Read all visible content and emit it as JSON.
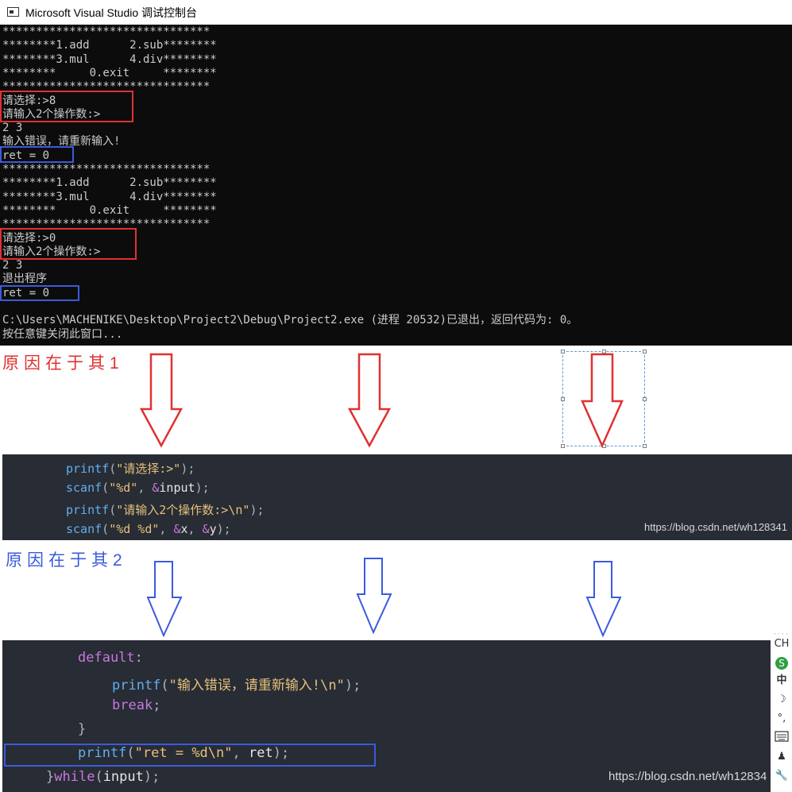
{
  "window": {
    "title": "Microsoft Visual Studio 调试控制台"
  },
  "console_lines": [
    "*******************************",
    "********1.add      2.sub********",
    "********3.mul      4.div********",
    "********     0.exit     ********",
    "*******************************",
    "请选择:>8",
    "请输入2个操作数:>",
    "2 3",
    "输入错误，请重新输入!",
    "ret = 0",
    "*******************************",
    "********1.add      2.sub********",
    "********3.mul      4.div********",
    "********     0.exit     ********",
    "*******************************",
    "请选择:>0",
    "请输入2个操作数:>",
    "2 3",
    "退出程序",
    "ret = 0",
    "",
    "C:\\Users\\MACHENIKE\\Desktop\\Project2\\Debug\\Project2.exe (进程 20532)已退出，返回代码为: 0。",
    "按任意键关闭此窗口..."
  ],
  "headings": {
    "reason1": "原因在于其1",
    "reason2": "原因在于其2"
  },
  "code1": {
    "l1": {
      "fn": "printf",
      "open": "(",
      "str": "\"请选择:>\"",
      "close": ");"
    },
    "l2": {
      "fn": "scanf",
      "open": "(",
      "str": "\"%d\"",
      "sep": ", ",
      "amp": "&",
      "id": "input",
      "close": ");"
    },
    "l3": {
      "fn": "printf",
      "open": "(",
      "str": "\"请输入2个操作数:>\\n\"",
      "close": ");"
    },
    "l4": {
      "fn": "scanf",
      "open": "(",
      "str": "\"%d %d\"",
      "sep1": ", ",
      "amp1": "&",
      "id1": "x",
      "sep2": ", ",
      "amp2": "&",
      "id2": "y",
      "close": ");"
    },
    "watermark": "https://blog.csdn.net/wh128341"
  },
  "code2": {
    "l1": {
      "kw": "default",
      "punc": ":"
    },
    "l2": {
      "fn": "printf",
      "open": "(",
      "str": "\"输入错误，请重新输入!\\n\"",
      "close": ");"
    },
    "l3": {
      "kw": "break",
      "punc": ";"
    },
    "l4": {
      "punc": "}"
    },
    "l5": {
      "fn": "printf",
      "open": "(",
      "str": "\"ret = %d\\n\"",
      "sep": ", ",
      "id": "ret",
      "close": ");"
    },
    "l6": {
      "brace": "}",
      "kw": "while",
      "open": "(",
      "id": "input",
      "close": ");"
    },
    "watermark": "https://blog.csdn.net/wh12834"
  },
  "ime": {
    "lang": "CH",
    "mode": "中"
  },
  "colors": {
    "red": "#e03131",
    "blue": "#3b5bdb",
    "console_bg": "#0c0c0c",
    "code_bg": "#282c34"
  }
}
